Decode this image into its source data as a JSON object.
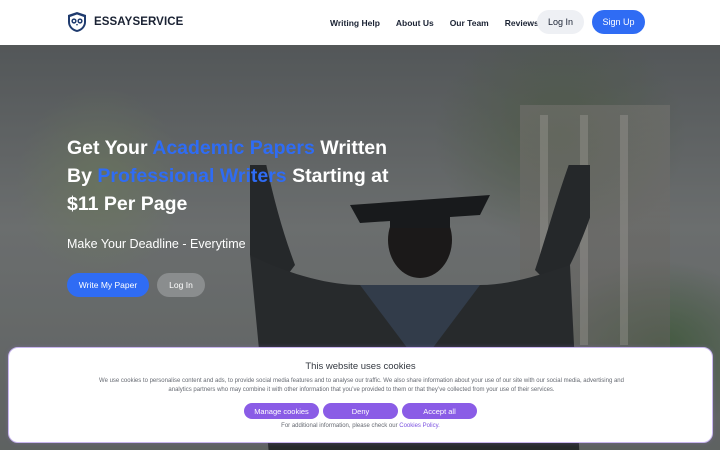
{
  "header": {
    "logo_text_a": "ESSAY",
    "logo_text_b": "SERVICE",
    "logo_icon": "owl-shield-icon",
    "nav": [
      "Writing Help",
      "About Us",
      "Our Team",
      "Reviews"
    ],
    "login_label": "Log In",
    "signup_label": "Sign Up"
  },
  "hero": {
    "title_1": "Get Your ",
    "title_accent_1": "Academic Papers",
    "title_2": " Written By ",
    "title_accent_2": "Professional Writers",
    "title_3": " Starting at $11 Per Page",
    "subtitle": "Make Your Deadline - Everytime",
    "write_label": "Write My Paper",
    "login_label": "Log In"
  },
  "cookie": {
    "title": "This website uses cookies",
    "text": "We use cookies to personalise content and ads, to provide social media features and to analyse our traffic. We also share information about your use of our site with our social media, advertising and analytics partners who may combine it with other information that you’ve provided to them or that they’ve collected from your use of their services.",
    "manage_label": "Manage cookies",
    "deny_label": "Deny",
    "accept_label": "Accept all",
    "foot_text": "For additional information, please check our ",
    "foot_link": "Cookies Policy."
  },
  "colors": {
    "brand": "#2f6cf4",
    "cookie_buttons": "#8a5ce6"
  }
}
